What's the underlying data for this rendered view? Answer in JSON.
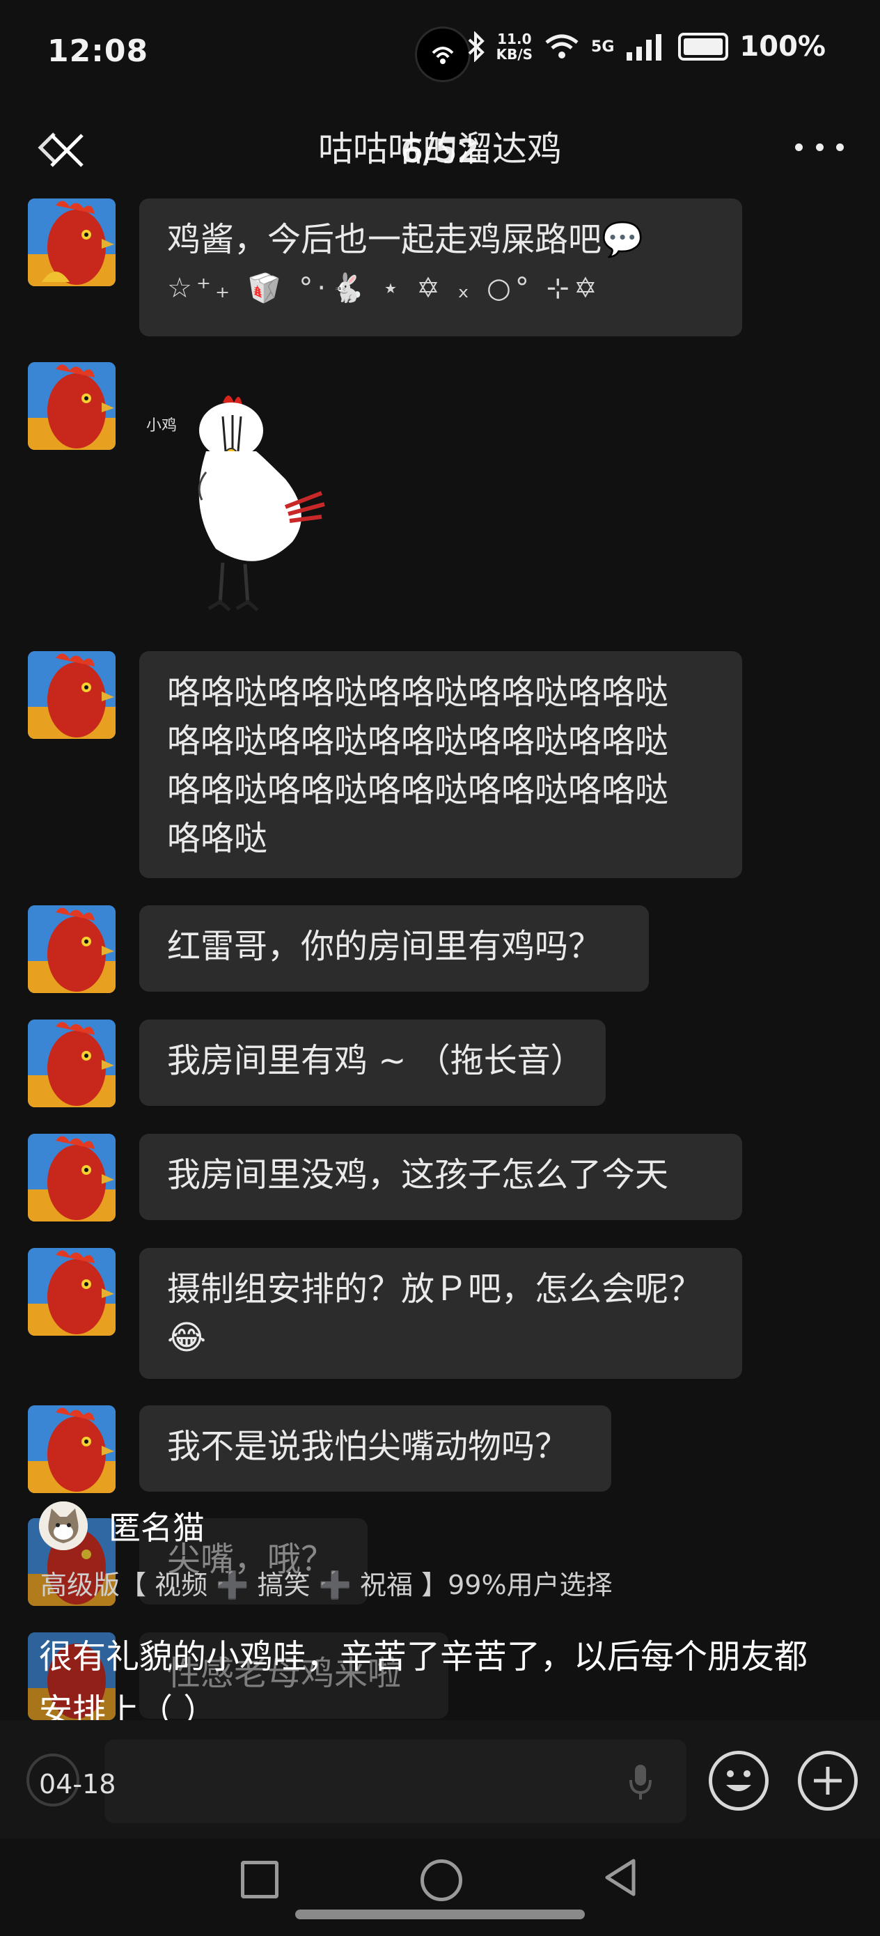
{
  "status_bar": {
    "time": "12:08",
    "net_speed_value": "11.0",
    "net_speed_unit": "KB/S",
    "network": "5G",
    "battery": "100%",
    "icons": [
      "hotspot-icon",
      "bluetooth-icon",
      "wifi-icon",
      "signal-icon",
      "battery-icon"
    ]
  },
  "header": {
    "title": "咕咕咕的溜达鸡",
    "page_counter": "6/52",
    "close_icon": "close-icon",
    "more_icon": "more-dots-icon"
  },
  "messages": [
    {
      "type": "text",
      "lines": [
        "鸡酱，今后也一起走鸡屎路吧💬"
      ],
      "deco": "☆⁺₊ 🥡 °·🐇 ⋆ ✡ ₓ ○° ⊹✡"
    },
    {
      "type": "sticker",
      "sticker_caption": "小鸡"
    },
    {
      "type": "text",
      "lines": [
        "咯咯哒咯咯哒咯咯哒咯咯哒咯咯哒",
        "咯咯哒咯咯哒咯咯哒咯咯哒咯咯哒",
        "咯咯哒咯咯哒咯咯哒咯咯哒咯咯哒",
        "咯咯哒"
      ]
    },
    {
      "type": "text",
      "lines": [
        "红雷哥，你的房间里有鸡吗？"
      ]
    },
    {
      "type": "text",
      "lines": [
        "我房间里有鸡 ~ （拖长音）"
      ]
    },
    {
      "type": "text",
      "lines": [
        "我房间里没鸡，这孩子怎么了今天"
      ]
    },
    {
      "type": "text",
      "lines": [
        "摄制组安排的？放Ｐ吧，怎么会呢？",
        "😂"
      ]
    },
    {
      "type": "text",
      "lines": [
        "我不是说我怕尖嘴动物吗？"
      ]
    },
    {
      "type": "text",
      "lines": [
        "尖嘴，哦？"
      ]
    },
    {
      "type": "text",
      "lines": [
        "性感老母鸡来啦"
      ]
    }
  ],
  "overlay": {
    "username": "匿名猫",
    "tags": "高级版【 视频 ➕ 搞笑 ➕ 祝福 】99%用户选择",
    "caption_line1": "很有礼貌的小鸡哇，辛苦了辛苦了，以后每个朋友都",
    "caption_line2": "安排上（ ）"
  },
  "input_bar": {
    "date": "04-18",
    "icons": [
      "voice-circle-icon",
      "mic-icon",
      "emoji-icon",
      "plus-icon"
    ]
  },
  "colors": {
    "background": "#111111",
    "bubble": "#2c2c2c",
    "text": "#eaeaea"
  }
}
